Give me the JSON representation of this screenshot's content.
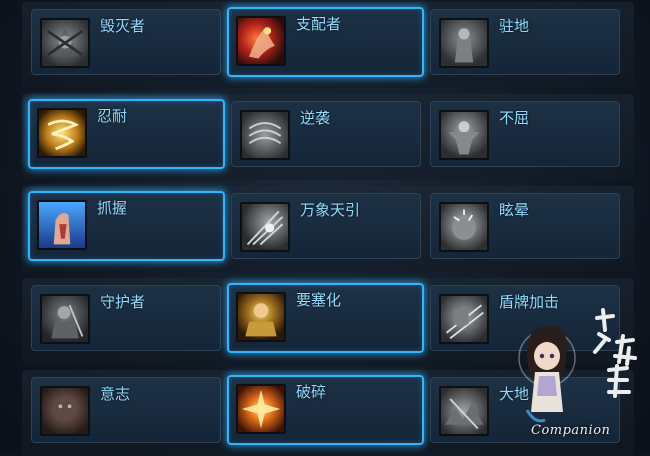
{
  "skills": [
    {
      "name": "毁灭者",
      "active": false,
      "icon": "destroyer-icon"
    },
    {
      "name": "支配者",
      "active": true,
      "icon": "dominator-icon"
    },
    {
      "name": "驻地",
      "active": false,
      "icon": "garrison-icon"
    },
    {
      "name": "忍耐",
      "active": true,
      "icon": "endurance-icon"
    },
    {
      "name": "逆袭",
      "active": false,
      "icon": "counterattack-icon"
    },
    {
      "name": "不屈",
      "active": false,
      "icon": "unyielding-icon"
    },
    {
      "name": "抓握",
      "active": true,
      "icon": "grasp-icon"
    },
    {
      "name": "万象天引",
      "active": false,
      "icon": "universal-pull-icon"
    },
    {
      "name": "眩晕",
      "active": false,
      "icon": "stun-icon"
    },
    {
      "name": "守护者",
      "active": false,
      "icon": "guardian-icon"
    },
    {
      "name": "要塞化",
      "active": true,
      "icon": "fortify-icon"
    },
    {
      "name": "盾牌加击",
      "active": false,
      "icon": "shield-bash-icon"
    },
    {
      "name": "意志",
      "active": false,
      "icon": "will-icon"
    },
    {
      "name": "破碎",
      "active": true,
      "icon": "shatter-icon"
    },
    {
      "name": "大地",
      "active": false,
      "icon": "earth-icon"
    }
  ],
  "watermark": {
    "text": "Companion",
    "logo": "攻略组"
  },
  "colors": {
    "accent": "#2fb6ff",
    "label": "#8fdcff",
    "card": "#1a2c3f"
  }
}
